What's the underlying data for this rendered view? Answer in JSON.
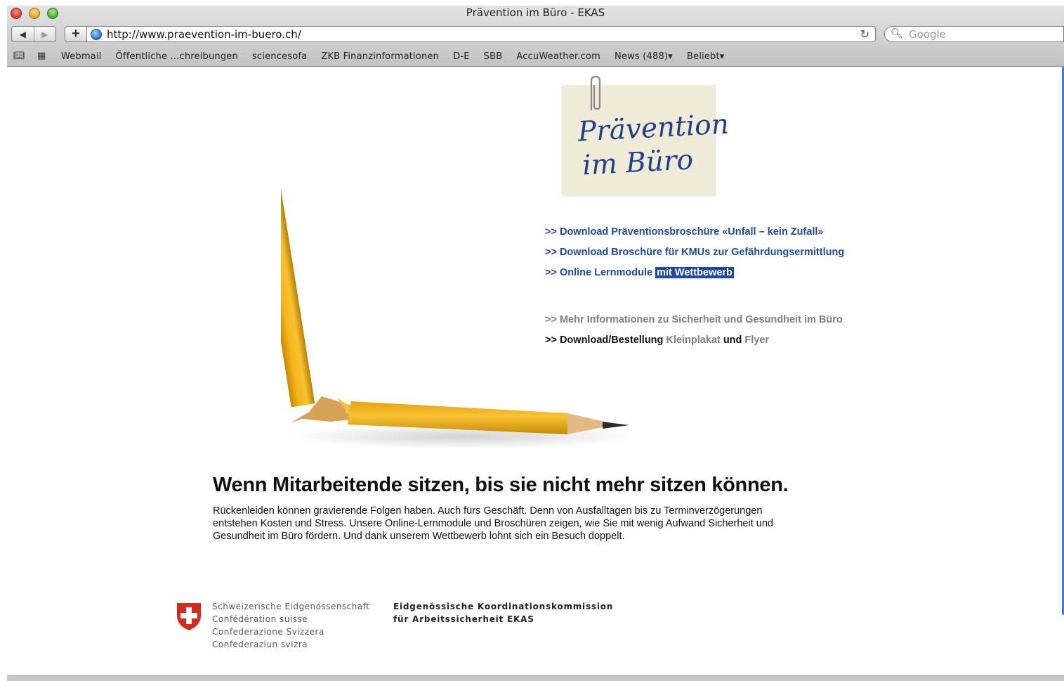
{
  "window": {
    "title": "Prävention im Büro - EKAS"
  },
  "toolbar": {
    "back_icon": "◀",
    "forward_icon": "▶",
    "add_icon": "+",
    "url": "http://www.praevention-im-buero.ch/",
    "reload_icon": "↻",
    "search_placeholder": "Google"
  },
  "bookmarks": [
    "Webmail",
    "Öffentliche ...chreibungen",
    "sciencesofa",
    "ZKB Finanzinformationen",
    "D-E",
    "SBB",
    "AccuWeather.com",
    "News (488)▾",
    "Beliebt▾"
  ],
  "note": {
    "line1": "Prävention",
    "line2": "im Büro"
  },
  "links": {
    "l1": ">> Download Präventionsbroschüre «Unfall – kein Zufall»",
    "l2": ">> Download Broschüre für KMUs zur Gefährdungsermittlung",
    "l3_prefix": ">> Online Lernmodule",
    "l3_highlight": "mit Wettbewerb",
    "l4": ">> Mehr Informationen zu Sicherheit und Gesundheit im Büro",
    "l5_prefix": ">> Download/Bestellung",
    "l5_kleinplakat": "Kleinplakat",
    "l5_und": "und",
    "l5_flyer": "Flyer"
  },
  "main": {
    "headline": "Wenn Mitarbeitende sitzen, bis sie nicht mehr sitzen können.",
    "body1": "Rückenleiden können gravierende Folgen haben. Auch fürs Geschäft. Denn von Ausfalltagen bis zu Terminverzögerungen",
    "body2": "entstehen Kosten und Stress. Unsere Online-Lernmodule und Broschüren zeigen, wie Sie mit wenig Aufwand Sicherheit und",
    "body3": "Gesundheit im Büro fördern. Und dank unserem Wettbewerb lohnt sich ein Besuch doppelt."
  },
  "footer": {
    "fed1": "Schweizerische Eidgenossenschaft",
    "fed2": "Confédération suisse",
    "fed3": "Confederazione Svizzera",
    "fed4": "Confederaziun svizra",
    "ekas1": "Eidgenössische Koordinationskommission",
    "ekas2": "für Arbeitssicherheit EKAS"
  }
}
